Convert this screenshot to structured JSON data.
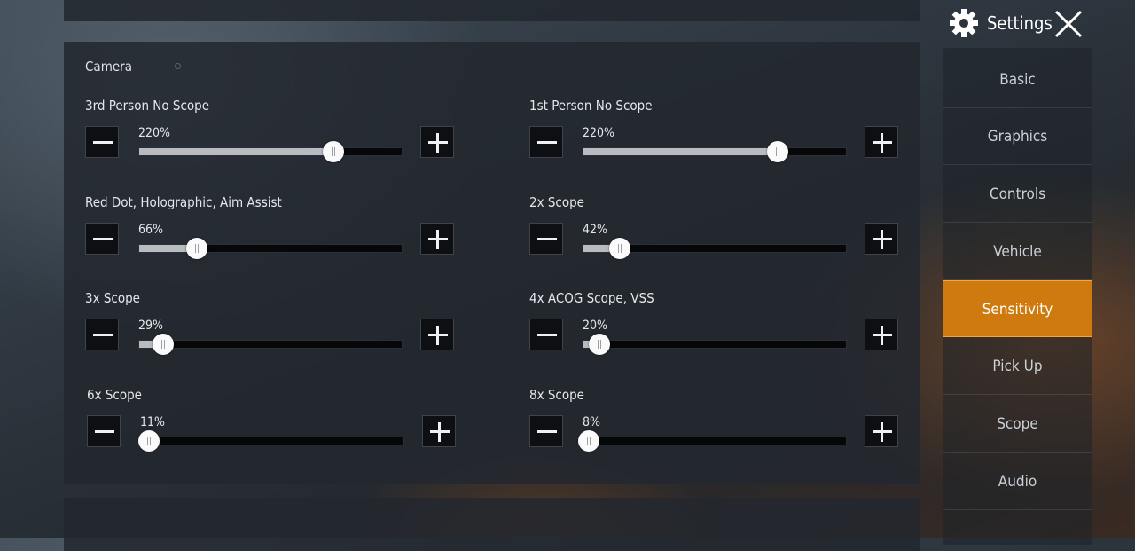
{
  "header": {
    "title": "Settings"
  },
  "nav": {
    "items": [
      {
        "label": "Basic",
        "active": false
      },
      {
        "label": "Graphics",
        "active": false
      },
      {
        "label": "Controls",
        "active": false
      },
      {
        "label": "Vehicle",
        "active": false
      },
      {
        "label": "Sensitivity",
        "active": true
      },
      {
        "label": "Pick Up",
        "active": false
      },
      {
        "label": "Scope",
        "active": false
      },
      {
        "label": "Audio",
        "active": false
      }
    ]
  },
  "camera": {
    "title": "Camera",
    "settings": [
      {
        "label": "3rd Person No Scope",
        "value": "220%",
        "fraction": 0.74
      },
      {
        "label": "1st Person No Scope",
        "value": "220%",
        "fraction": 0.74
      },
      {
        "label": "Red Dot, Holographic, Aim Assist",
        "value": "66%",
        "fraction": 0.22
      },
      {
        "label": "2x Scope",
        "value": "42%",
        "fraction": 0.14
      },
      {
        "label": "3x Scope",
        "value": "29%",
        "fraction": 0.09
      },
      {
        "label": "4x ACOG Scope, VSS",
        "value": "20%",
        "fraction": 0.06
      },
      {
        "label": "6x Scope",
        "value": "11%",
        "fraction": 0.03
      },
      {
        "label": "8x Scope",
        "value": "8%",
        "fraction": 0.02
      }
    ]
  },
  "colors": {
    "accent": "#cf7a0e",
    "accent_border": "#f2a640"
  }
}
